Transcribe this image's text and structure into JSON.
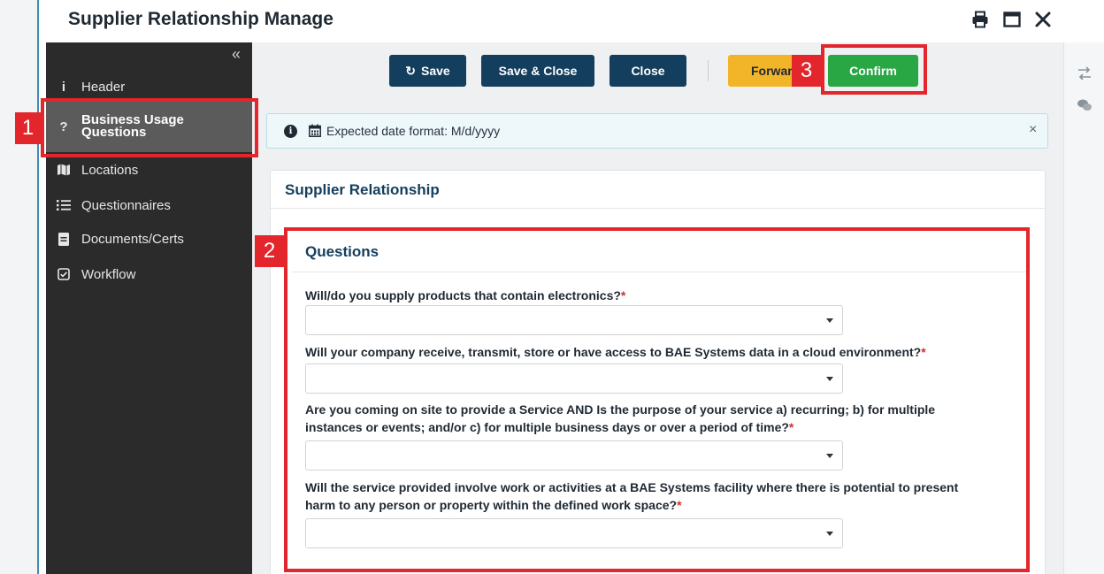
{
  "window": {
    "title": "Supplier Relationship Manage",
    "icons": [
      "print-icon",
      "maximize-icon",
      "close-icon"
    ]
  },
  "sidebar": {
    "collapse_icon": "double-chevron-left-icon",
    "items": [
      {
        "label": "Header",
        "icon": "info-icon",
        "glyph": "i"
      },
      {
        "label_line1": "Business Usage",
        "label_line2": "Questions",
        "icon": "question-icon",
        "glyph": "?",
        "active": true
      },
      {
        "label": "Locations",
        "icon": "map-icon"
      },
      {
        "label": "Questionnaires",
        "icon": "list-icon"
      },
      {
        "label": "Documents/Certs",
        "icon": "document-icon"
      },
      {
        "label": "Workflow",
        "icon": "checkbox-icon"
      }
    ]
  },
  "toolbar": {
    "save_label": "Save",
    "save_close_label": "Save & Close",
    "close_label": "Close",
    "forward_label": "Forward",
    "confirm_label": "Confirm"
  },
  "banner": {
    "text": "Expected date format: M/d/yyyy",
    "close_glyph": "×"
  },
  "card": {
    "title": "Supplier Relationship",
    "section_title": "Questions",
    "questions": [
      {
        "text": "Will/do you supply products that contain electronics?",
        "required_mark": "*",
        "value": ""
      },
      {
        "text": "Will your company receive, transmit, store or have access to BAE Systems data in a cloud environment?",
        "required_mark": "*",
        "value": ""
      },
      {
        "text_line1": "Are you coming on site to provide a Service AND Is the purpose of your service a) recurring; b) for multiple",
        "text_line2": "instances or events; and/or c) for multiple business days or over a period of time?",
        "required_mark": "*",
        "value": ""
      },
      {
        "text_line1": "Will the service provided involve work or activities at a BAE Systems facility where there is potential to present",
        "text_line2": "harm to any person or property within the defined work space?",
        "required_mark": "*",
        "value": ""
      }
    ]
  },
  "annotations": [
    {
      "label": "1"
    },
    {
      "label": "2"
    },
    {
      "label": "3"
    }
  ],
  "colors": {
    "primary_button": "#143e5d",
    "confirm_button": "#2aa745",
    "forward_button": "#f2b428",
    "sidebar_bg": "#2b2b2b",
    "annotation": "#e3262b"
  }
}
